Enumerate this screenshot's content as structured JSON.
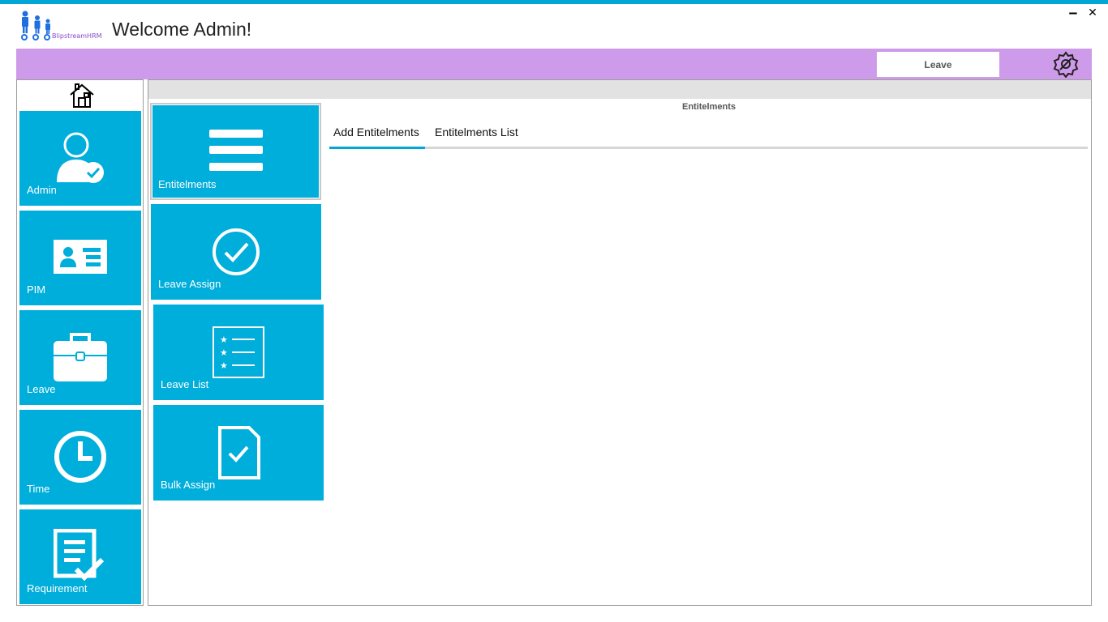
{
  "header": {
    "logo_text": "BlipstreamHRM",
    "welcome": "Welcome Admin!",
    "minimize": "‒",
    "close": "✕",
    "module_chip": "Leave"
  },
  "sidebar": {
    "items": [
      {
        "label": "Admin",
        "icon": "admin-user-check-icon"
      },
      {
        "label": "PIM",
        "icon": "id-card-icon"
      },
      {
        "label": "Leave",
        "icon": "briefcase-icon"
      },
      {
        "label": "Time",
        "icon": "clock-icon"
      },
      {
        "label": "Requirement",
        "icon": "document-check-icon"
      }
    ]
  },
  "leave_menu": {
    "items": [
      {
        "label": "Entitelments",
        "icon": "menu-lines-icon"
      },
      {
        "label": "Leave Assign",
        "icon": "check-circle-icon"
      },
      {
        "label": "Leave List",
        "icon": "star-list-icon"
      },
      {
        "label": "Bulk Assign",
        "icon": "document-check-icon"
      }
    ]
  },
  "panel": {
    "title": "Entitelments",
    "tabs": [
      {
        "label": "Add Entitelments",
        "active": true
      },
      {
        "label": "Entitelments List",
        "active": false
      }
    ]
  },
  "colors": {
    "accent": "#00aedb",
    "topstrip": "#00a7d6",
    "purple_bar": "#cd9be9"
  }
}
